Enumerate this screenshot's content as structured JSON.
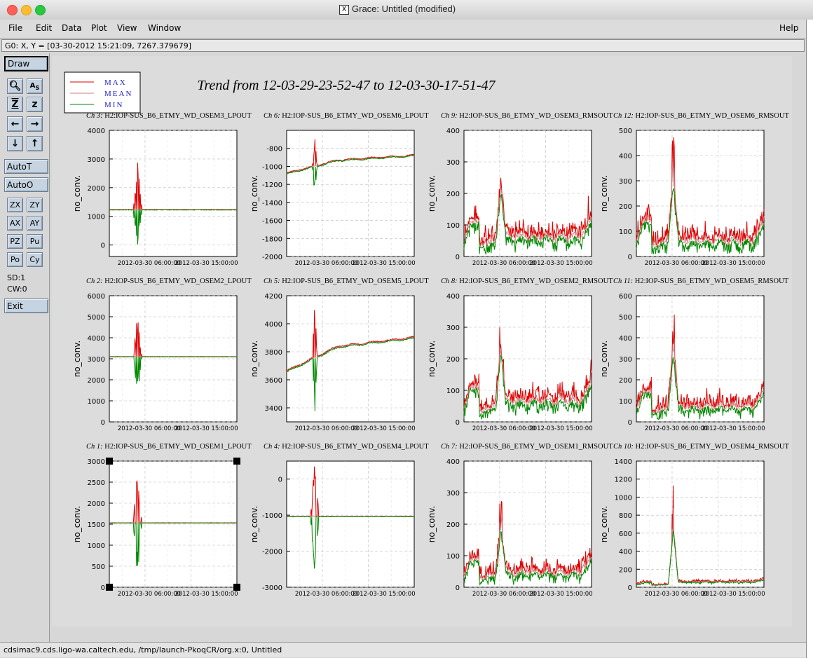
{
  "window": {
    "title": "Grace: Untitled (modified)"
  },
  "menu": {
    "items": [
      "File",
      "Edit",
      "Data",
      "Plot",
      "View",
      "Window"
    ],
    "help": "Help"
  },
  "coord_readout": "G0: X, Y = [03-30-2012 15:21:09, 7267.379679]",
  "toolbar": {
    "draw": "Draw",
    "autot": "AutoT",
    "autoo": "AutoO",
    "zx": "ZX",
    "zy": "ZY",
    "ax": "AX",
    "ay": "AY",
    "pz": "PZ",
    "pu": "Pu",
    "po": "Po",
    "cy": "Cy",
    "sd": "SD:1",
    "cw": "CW:0",
    "exit": "Exit",
    "icons": [
      "zoom-icon",
      "autoscale-icon",
      "zoom-z-icon",
      "zoom-out-z-icon",
      "left-arrow-icon",
      "right-arrow-icon",
      "down-arrow-icon",
      "up-arrow-icon"
    ]
  },
  "status": "cdsimac9.cds.ligo-wa.caltech.edu, /tmp/launch-PkoqCR/org.x:0, Untitled",
  "plot": {
    "title": "Trend from 12-03-29-23-52-47 to 12-03-30-17-51-47",
    "legend": [
      {
        "name": "MAX",
        "color": "#e00000"
      },
      {
        "name": "MEAN",
        "color": "#d08080"
      },
      {
        "name": "MIN",
        "color": "#008800"
      }
    ],
    "ylabel": "no_conv.",
    "xticks": [
      "2012-03-30 06:00:00",
      "2012-03-30 15:00:00"
    ]
  },
  "chart_data": [
    {
      "type": "line",
      "title": "Ch 3: H2:IOP-SUS_B6_ETMY_WD_OSEM3_LPOUT",
      "ylabel": "no_conv.",
      "ylim": [
        -400,
        4000
      ],
      "yticks": [
        0,
        1000,
        2000,
        3000,
        4000
      ],
      "baseline": 1230,
      "spike": {
        "at": 0.22,
        "hi": 3100,
        "lo": -350
      },
      "noise": 30,
      "kind": "flat"
    },
    {
      "type": "line",
      "title": "Ch 6: H2:IOP-SUS_B6_ETMY_WD_OSEM6_LPOUT",
      "ylabel": "no_conv.",
      "ylim": [
        -2000,
        -600
      ],
      "yticks": [
        -2000,
        -1800,
        -1600,
        -1400,
        -1200,
        -1000,
        -800
      ],
      "start": -1080,
      "end": -880,
      "spike": {
        "at": 0.22,
        "hi": -650,
        "lo": -1360
      },
      "noise": 10,
      "kind": "ramp"
    },
    {
      "type": "line",
      "title": "Ch 9: H2:IOP-SUS_B6_ETMY_WD_OSEM3_RMSOUT",
      "ylabel": "no_conv.",
      "ylim": [
        0,
        400
      ],
      "yticks": [
        0,
        100,
        200,
        300,
        400
      ],
      "kind": "rms",
      "base": 60,
      "peak": 345,
      "scale": 1.0
    },
    {
      "type": "line",
      "title": "Ch 12: H2:IOP-SUS_B6_ETMY_WD_OSEM6_RMSOUT",
      "ylabel": "no_conv.",
      "ylim": [
        0,
        500
      ],
      "yticks": [
        0,
        100,
        200,
        300,
        400,
        500
      ],
      "kind": "rms",
      "base": 60,
      "peak": 480,
      "scale": 1.25
    },
    {
      "type": "line",
      "title": "Ch 2: H2:IOP-SUS_B6_ETMY_WD_OSEM2_LPOUT",
      "ylabel": "no_conv.",
      "ylim": [
        0,
        6000
      ],
      "yticks": [
        0,
        1000,
        2000,
        3000,
        4000,
        5000,
        6000
      ],
      "baseline": 3100,
      "spike": {
        "at": 0.22,
        "hi": 5100,
        "lo": 1100
      },
      "noise": 20,
      "kind": "flat"
    },
    {
      "type": "line",
      "title": "Ch 5: H2:IOP-SUS_B6_ETMY_WD_OSEM5_LPOUT",
      "ylabel": "no_conv.",
      "ylim": [
        3300,
        4200
      ],
      "yticks": [
        3400,
        3600,
        3800,
        4000,
        4200
      ],
      "start": 3660,
      "end": 3900,
      "spike": {
        "at": 0.22,
        "hi": 4190,
        "lo": 3320
      },
      "noise": 8,
      "kind": "ramp"
    },
    {
      "type": "line",
      "title": "Ch 8: H2:IOP-SUS_B6_ETMY_WD_OSEM2_RMSOUT",
      "ylabel": "no_conv.",
      "ylim": [
        0,
        400
      ],
      "yticks": [
        0,
        100,
        200,
        300,
        400
      ],
      "kind": "rms",
      "base": 65,
      "peak": 370,
      "scale": 1.0
    },
    {
      "type": "line",
      "title": "Ch 11: H2:IOP-SUS_B6_ETMY_WD_OSEM5_RMSOUT",
      "ylabel": "no_conv.",
      "ylim": [
        0,
        600
      ],
      "yticks": [
        0,
        100,
        200,
        300,
        400,
        500,
        600
      ],
      "kind": "rms",
      "base": 70,
      "peak": 560,
      "scale": 1.3
    },
    {
      "type": "line",
      "title": "Ch 1: H2:IOP-SUS_B6_ETMY_WD_OSEM1_LPOUT",
      "ylabel": "no_conv.",
      "ylim": [
        0,
        3000
      ],
      "yticks": [
        0,
        500,
        1000,
        1500,
        2000,
        2500,
        3000
      ],
      "baseline": 1530,
      "spike": {
        "at": 0.22,
        "hi": 2900,
        "lo": 170
      },
      "noise": 12,
      "kind": "flat"
    },
    {
      "type": "line",
      "title": "Ch 4: H2:IOP-SUS_B6_ETMY_WD_OSEM4_LPOUT",
      "ylabel": "no_conv.",
      "ylim": [
        -3000,
        500
      ],
      "yticks": [
        -3000,
        -2000,
        -1000,
        0
      ],
      "baseline": -1040,
      "spike": {
        "at": 0.22,
        "hi": 480,
        "lo": -2650
      },
      "noise": 15,
      "kind": "flat"
    },
    {
      "type": "line",
      "title": "Ch 7: H2:IOP-SUS_B6_ETMY_WD_OSEM1_RMSOUT",
      "ylabel": "no_conv.",
      "ylim": [
        0,
        400
      ],
      "yticks": [
        0,
        100,
        200,
        300,
        400
      ],
      "kind": "rms",
      "base": 45,
      "peak": 300,
      "scale": 0.8
    },
    {
      "type": "line",
      "title": "Ch 10: H2:IOP-SUS_B6_ETMY_WD_OSEM4_RMSOUT",
      "ylabel": "no_conv.",
      "ylim": [
        0,
        1400
      ],
      "yticks": [
        0,
        200,
        400,
        600,
        800,
        1000,
        1200,
        1400
      ],
      "kind": "rms",
      "base": 60,
      "peak": 1150,
      "scale": 0.5
    }
  ]
}
